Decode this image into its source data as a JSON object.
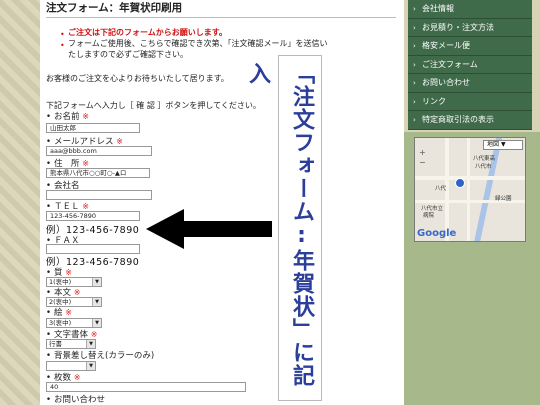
{
  "form": {
    "title": "注文フォーム：年賀状印刷用",
    "notice_red": "ご注文は下記のフォームからお願いします。",
    "notice_black_1": "フォームご使用後、こちらで確認でき次第、「注文確認メール」を送信い",
    "notice_black_2": "たしますので必ずご確認下さい。",
    "welcome": "お客様のご注文を心よりお待ちいたして居ります。",
    "instruction": "下記フォームへ入力し［ 確 認 ］ボタンを押してください。",
    "required_mark": "※",
    "fields": {
      "name": {
        "label": "お名前",
        "value": "山田太郎"
      },
      "email": {
        "label": "メールアドレス",
        "value": "aaa@bbb.com"
      },
      "address": {
        "label": "住　所",
        "value": "熊本県八代市○○町○-▲ロ"
      },
      "company": {
        "label": "会社名",
        "value": ""
      },
      "tel": {
        "label": "ＴＥＬ",
        "value": "123-456-7890",
        "example": "例）123-456-7890"
      },
      "fax": {
        "label": "ＦＡＸ",
        "value": "",
        "example": "例）123-456-7890"
      },
      "quality": {
        "label": "質",
        "value": "1(衷中)"
      },
      "body": {
        "label": "本文",
        "value": "2(衷中)"
      },
      "picture": {
        "label": "絵",
        "value": "3(衷中)"
      },
      "font": {
        "label": "文字書体",
        "value": "行書"
      },
      "background": {
        "label": "背景差し替え(カラーのみ)",
        "value": ""
      },
      "count": {
        "label": "枚数",
        "value": "40"
      },
      "inquiry": {
        "label": "お問い合わせ",
        "value": ""
      }
    }
  },
  "nav": {
    "items": [
      {
        "label": "会社情報"
      },
      {
        "label": "お見積り・注文方法"
      },
      {
        "label": "格安メール便"
      },
      {
        "label": "ご注文フォーム"
      },
      {
        "label": "お問い合わせ"
      },
      {
        "label": "リンク"
      },
      {
        "label": "特定商取引法の表示"
      }
    ],
    "chevron": "›"
  },
  "map": {
    "type_label": "地図",
    "type_arrow": "▼",
    "zoom_in": "+",
    "zoom_out": "−",
    "logo": "Google",
    "labels": [
      "八代東高",
      "八代市",
      "八代",
      "八代市立",
      "病院",
      "緑公園"
    ]
  },
  "callout": {
    "text": "「注文フォーム:年賀状」に記入",
    "arrow_color": "#000000",
    "text_color": "#2a3e9a"
  },
  "colors": {
    "nav_bg": "#3f6b4a",
    "required": "#e02020",
    "side_green": "#a7b98a"
  }
}
